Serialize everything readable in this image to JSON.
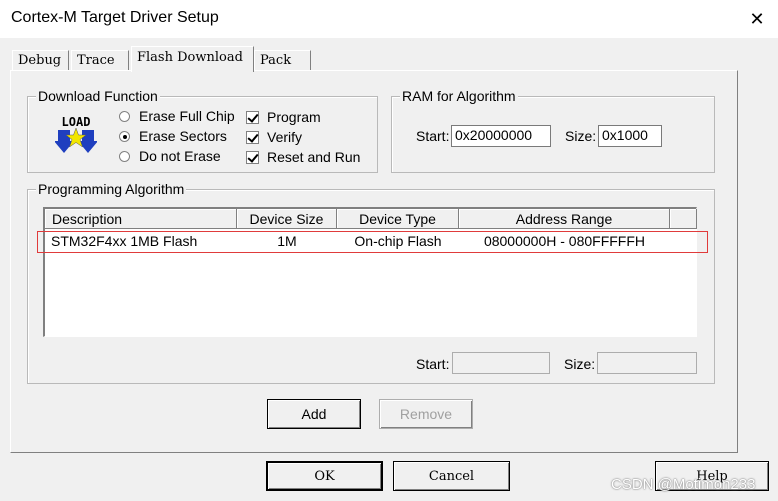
{
  "window": {
    "title": "Cortex-M Target Driver Setup",
    "close_glyph": "✕"
  },
  "tabs": [
    {
      "label": "Debug"
    },
    {
      "label": "Trace"
    },
    {
      "label": "Flash Download",
      "active": true
    },
    {
      "label": "Pack"
    }
  ],
  "download_function": {
    "legend": "Download Function",
    "icon_text": "LOAD",
    "erase_options": [
      {
        "label": "Erase Full Chip",
        "selected": false
      },
      {
        "label": "Erase Sectors",
        "selected": true
      },
      {
        "label": "Do not Erase",
        "selected": false
      }
    ],
    "checks": [
      {
        "label": "Program",
        "checked": true
      },
      {
        "label": "Verify",
        "checked": true
      },
      {
        "label": "Reset and Run",
        "checked": true
      }
    ]
  },
  "ram_for_algorithm": {
    "legend": "RAM for Algorithm",
    "start_label": "Start:",
    "start_value": "0x20000000",
    "size_label": "Size:",
    "size_value": "0x1000"
  },
  "programming_algorithm": {
    "legend": "Programming Algorithm",
    "columns": [
      "Description",
      "Device Size",
      "Device Type",
      "Address Range"
    ],
    "rows": [
      {
        "description": "STM32F4xx 1MB Flash",
        "device_size": "1M",
        "device_type": "On-chip Flash",
        "address_range": "08000000H - 080FFFFFH"
      }
    ],
    "start_label": "Start:",
    "start_value": "",
    "size_label": "Size:",
    "size_value": "",
    "add_label": "Add",
    "remove_label": "Remove"
  },
  "footer": {
    "ok_label": "OK",
    "cancel_label": "Cancel",
    "help_label": "Help"
  },
  "watermark": "CSDN @Motimon233",
  "colors": {
    "highlight_border": "#e03b3b",
    "load_icon_arrow": "#1f3fbf",
    "load_icon_star": "#f2e600"
  }
}
